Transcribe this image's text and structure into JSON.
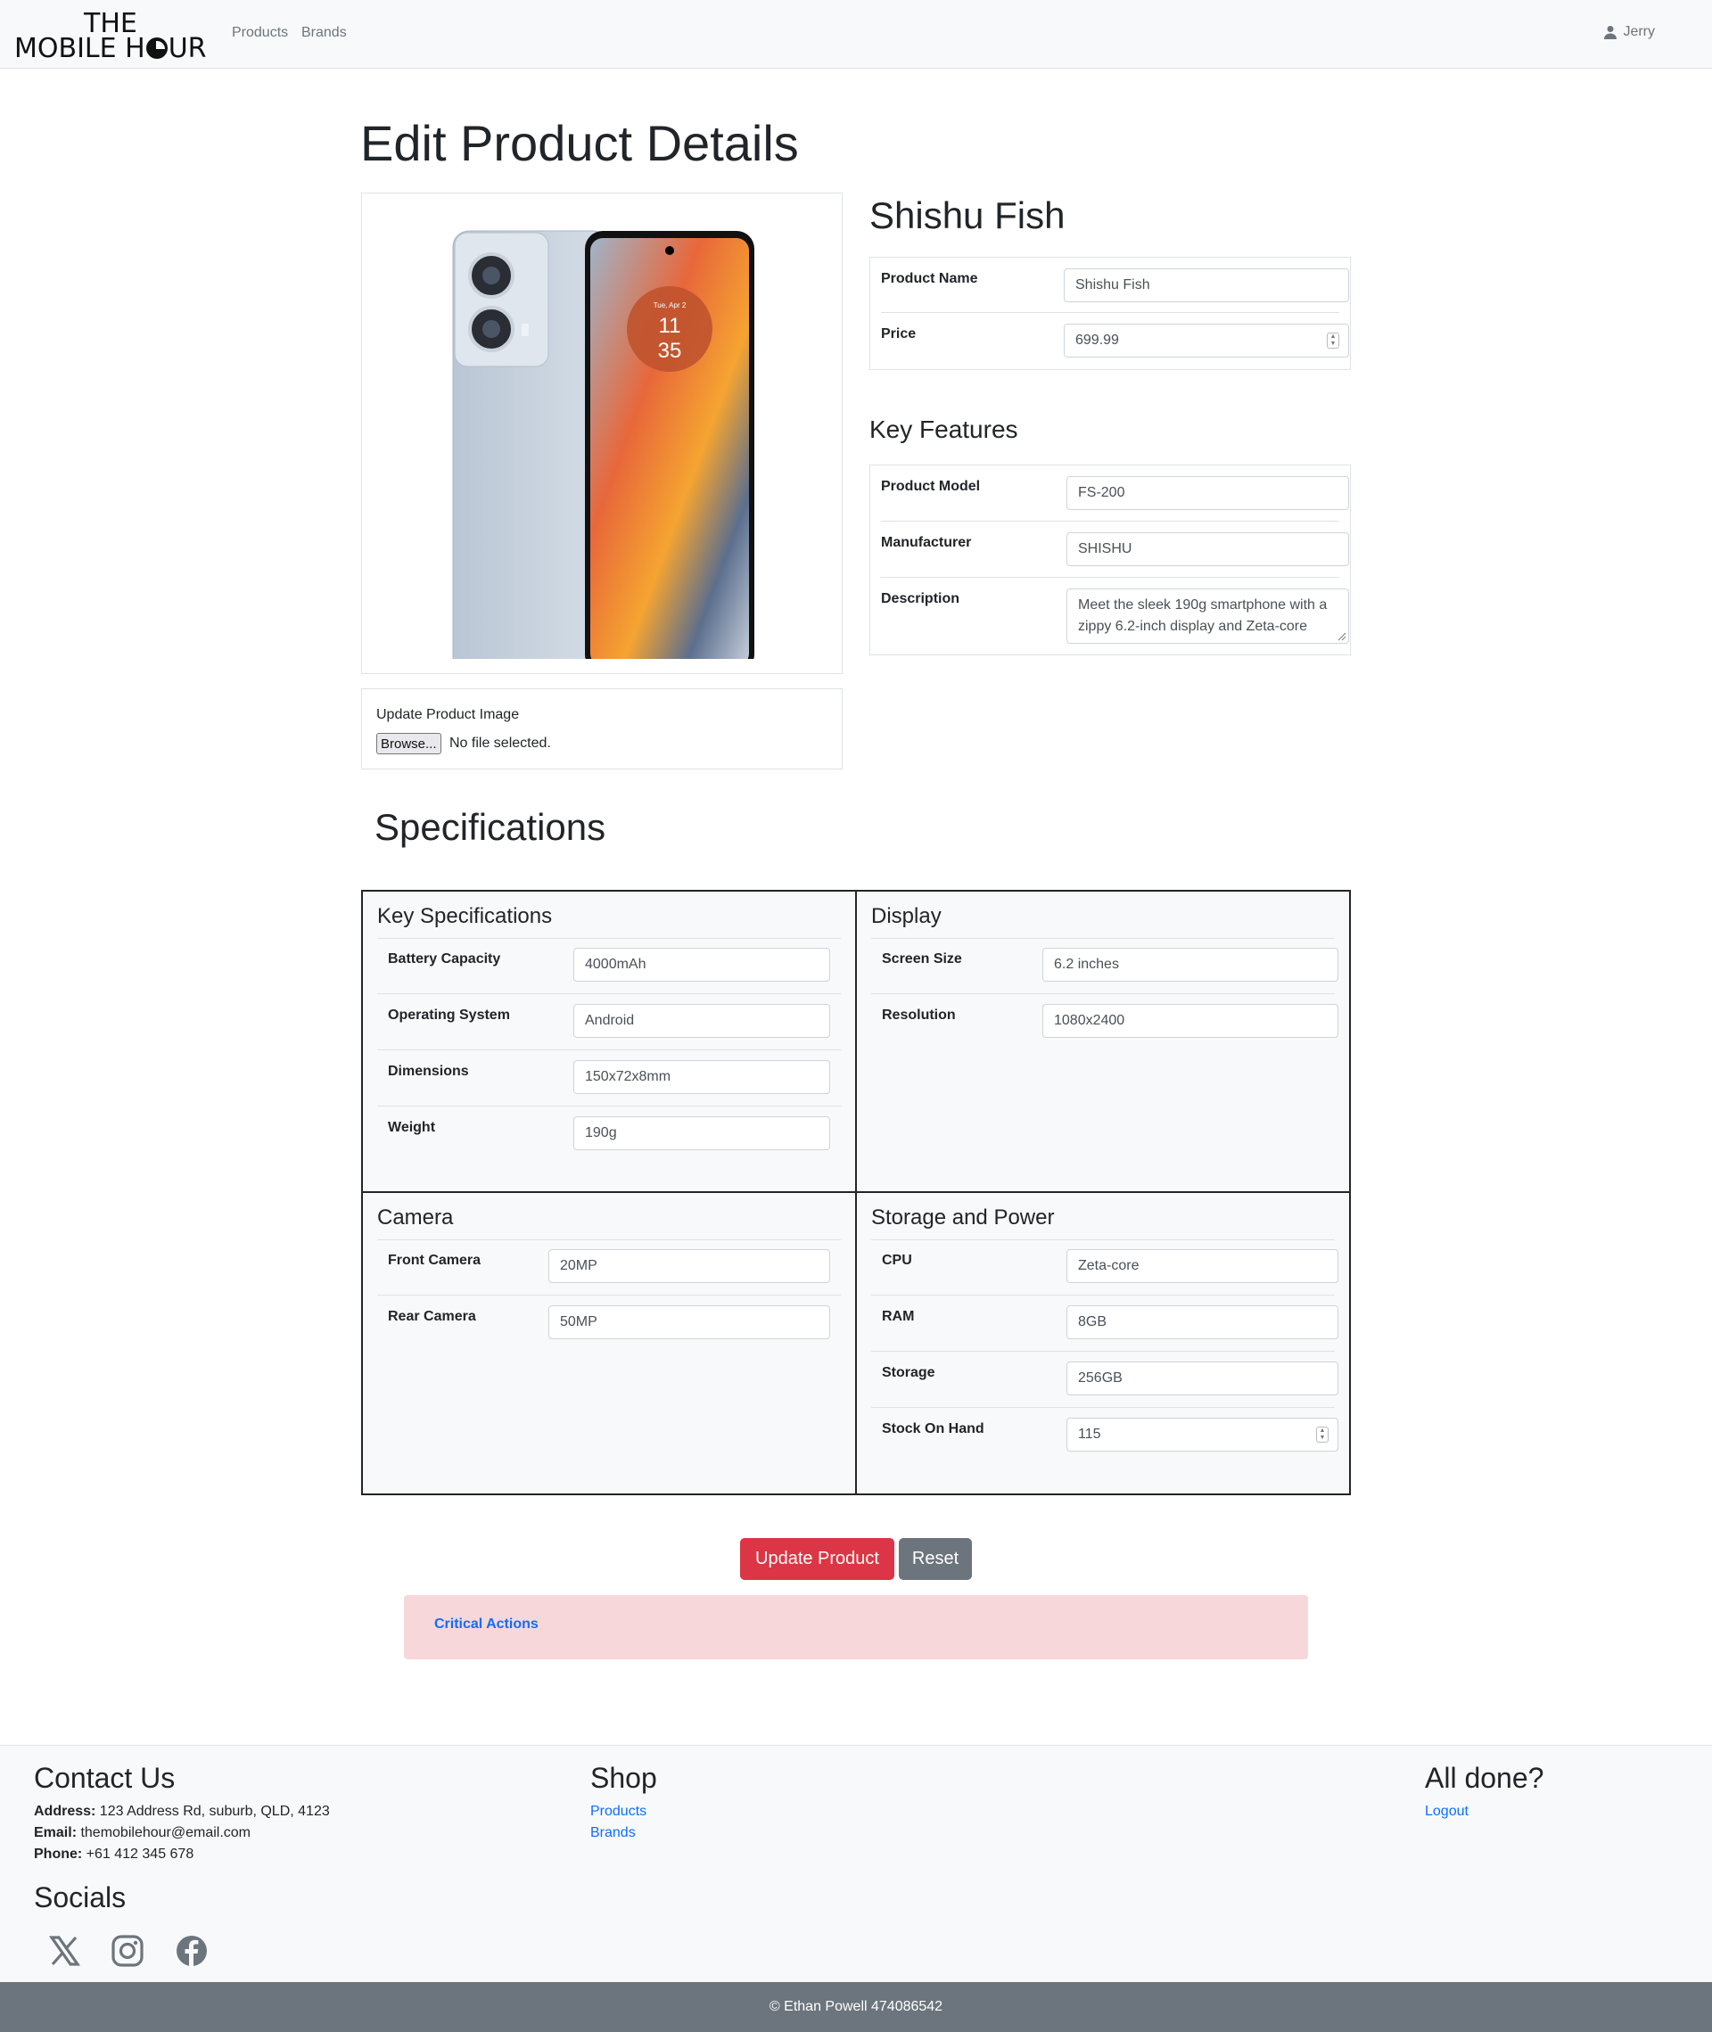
{
  "header": {
    "logo_line1": "THE",
    "logo_line2a": "MOBILE H",
    "logo_line2b": "UR",
    "nav": {
      "products": "Products",
      "brands": "Brands"
    },
    "user_name": "Jerry"
  },
  "page": {
    "title": "Edit Product Details",
    "product_heading": "Shishu Fish",
    "key_features_heading": "Key Features",
    "update_image_label": "Update Product Image",
    "browse_label": "Browse...",
    "no_file_text": "No file selected."
  },
  "product": {
    "name_label": "Product Name",
    "name_value": "Shishu Fish",
    "price_label": "Price",
    "price_value": "699.99"
  },
  "key_features": {
    "model_label": "Product Model",
    "model_value": "FS-200",
    "manufacturer_label": "Manufacturer",
    "manufacturer_value": "SHISHU",
    "description_label": "Description",
    "description_value": "Meet the sleek 190g smartphone with a zippy 6.2-inch display and Zeta-core"
  },
  "phone_screen": {
    "date": "Tue, Apr 2",
    "hour": "11",
    "minute": "35"
  },
  "specs": {
    "heading": "Specifications",
    "key_specs": {
      "title": "Key Specifications",
      "battery_label": "Battery Capacity",
      "battery_value": "4000mAh",
      "os_label": "Operating System",
      "os_value": "Android",
      "dimensions_label": "Dimensions",
      "dimensions_value": "150x72x8mm",
      "weight_label": "Weight",
      "weight_value": "190g"
    },
    "display": {
      "title": "Display",
      "screen_label": "Screen Size",
      "screen_value": "6.2 inches",
      "resolution_label": "Resolution",
      "resolution_value": "1080x2400"
    },
    "camera": {
      "title": "Camera",
      "front_label": "Front Camera",
      "front_value": "20MP",
      "rear_label": "Rear Camera",
      "rear_value": "50MP"
    },
    "storage": {
      "title": "Storage and Power",
      "cpu_label": "CPU",
      "cpu_value": "Zeta-core",
      "ram_label": "RAM",
      "ram_value": "8GB",
      "storage_label": "Storage",
      "storage_value": "256GB",
      "stock_label": "Stock On Hand",
      "stock_value": "115"
    }
  },
  "actions": {
    "update": "Update Product",
    "reset": "Reset",
    "critical": "Critical Actions"
  },
  "footer": {
    "contact_heading": "Contact Us",
    "address_label": "Address:",
    "address_value": " 123 Address Rd, suburb, QLD, 4123",
    "email_label": "Email:",
    "email_value": " themobilehour@email.com",
    "phone_label": "Phone:",
    "phone_value": " +61 412 345 678",
    "socials_heading": "Socials",
    "shop_heading": "Shop",
    "shop_products": "Products",
    "shop_brands": "Brands",
    "done_heading": "All done?",
    "logout": "Logout",
    "copyright": "© Ethan Powell 474086542"
  },
  "icons": [
    "user-icon",
    "x-icon",
    "instagram-icon",
    "facebook-icon"
  ],
  "colors": {
    "danger": "#dc3545",
    "secondary": "#6c757d",
    "link": "#0d6efd",
    "alert_bg": "#f8d7da"
  }
}
